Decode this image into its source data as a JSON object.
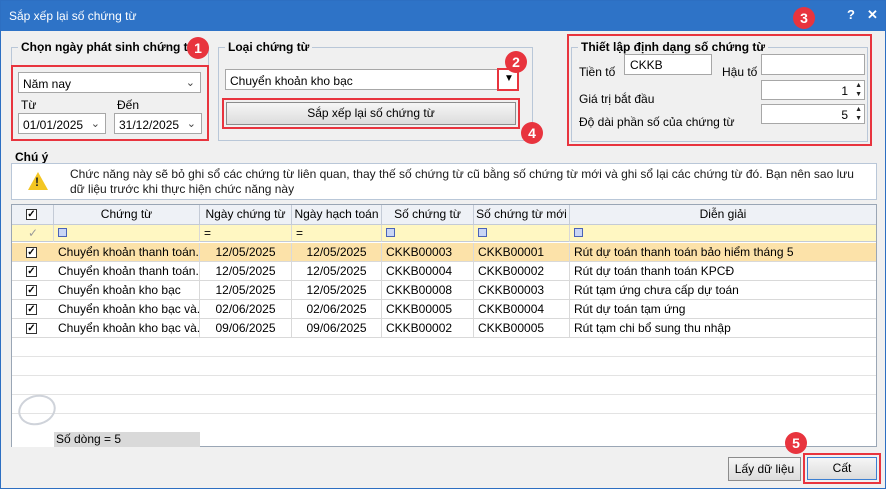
{
  "window": {
    "title": "Sắp xếp lại số chứng từ",
    "help": "?",
    "close": "✕"
  },
  "date_group": {
    "title": "Chọn ngày phát sinh chứng từ",
    "period": "Năm nay",
    "from_label": "Từ",
    "to_label": "Đến",
    "from": "01/01/2025",
    "to": "31/12/2025"
  },
  "type_group": {
    "title": "Loại chứng từ",
    "value": "Chuyển khoản kho bạc",
    "sort_button": "Sắp xếp lại số chứng từ"
  },
  "format_group": {
    "title": "Thiết lập định dạng số chứng từ",
    "prefix_label": "Tiền tố",
    "prefix": "CKKB",
    "suffix_label": "Hậu tố",
    "suffix": "",
    "start_label": "Giá trị bắt đầu",
    "start": "1",
    "length_label": "Độ dài phần số của chứng từ",
    "length": "5"
  },
  "note": {
    "title": "Chú ý",
    "text": "Chức năng này sẽ bỏ ghi sổ các chứng từ liên quan, thay thế số chứng từ cũ bằng số chứng từ mới và ghi sổ lại các chứng từ đó. Bạn nên sao lưu dữ liệu trước khi thực hiện chức năng này"
  },
  "badges": [
    "1",
    "2",
    "3",
    "4",
    "5"
  ],
  "grid": {
    "columns": [
      "Chứng từ",
      "Ngày chứng từ",
      "Ngày hạch toán",
      "Số chứng từ",
      "Số chứng từ mới",
      "Diễn giải"
    ],
    "filter_eq": "=",
    "rows": [
      {
        "type": "Chuyển khoản thanh toán...",
        "doc_date": "12/05/2025",
        "post_date": "12/05/2025",
        "number": "CKKB00003",
        "new_number": "CKKB00001",
        "desc": "Rút dự toán thanh toán bảo hiểm tháng 5"
      },
      {
        "type": "Chuyển khoản thanh toán...",
        "doc_date": "12/05/2025",
        "post_date": "12/05/2025",
        "number": "CKKB00004",
        "new_number": "CKKB00002",
        "desc": "Rút dự toán thanh toán KPCĐ"
      },
      {
        "type": "Chuyển khoản kho bạc",
        "doc_date": "12/05/2025",
        "post_date": "12/05/2025",
        "number": "CKKB00008",
        "new_number": "CKKB00003",
        "desc": "Rút tạm ứng chưa cấp dự toán"
      },
      {
        "type": "Chuyển khoản kho bạc và...",
        "doc_date": "02/06/2025",
        "post_date": "02/06/2025",
        "number": "CKKB00005",
        "new_number": "CKKB00004",
        "desc": "Rút dự toán tạm ứng"
      },
      {
        "type": "Chuyển khoản kho bạc và...",
        "doc_date": "09/06/2025",
        "post_date": "09/06/2025",
        "number": "CKKB00002",
        "new_number": "CKKB00005",
        "desc": "Rút tạm chi bổ sung thu nhập"
      }
    ],
    "row_count": "Số dòng = 5"
  },
  "buttons": {
    "load": "Lấy dữ liệu",
    "save": "Cất"
  },
  "colors": {
    "title_bar": "#2e73c7",
    "highlight": "#e8343e",
    "selected_row": "#fce2a9",
    "filter_row": "#fff7c2"
  }
}
